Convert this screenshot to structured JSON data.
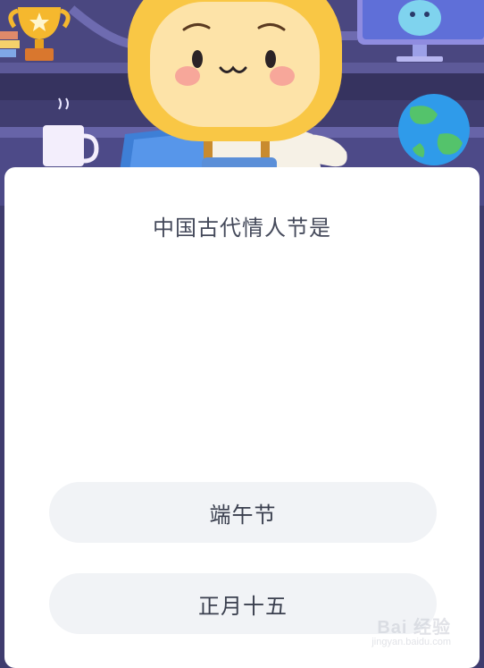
{
  "quiz": {
    "question": "中国古代情人节是",
    "options": [
      {
        "label": "端午节"
      },
      {
        "label": "正月十五"
      }
    ]
  },
  "watermark": {
    "logo": "Bai 经验",
    "url": "jingyan.baidu.com"
  },
  "colors": {
    "banner_bg": "#3f3c6e",
    "card_bg": "#ffffff",
    "option_bg": "#f1f3f6",
    "question_text": "#44495a",
    "character_yellow": "#f9c745"
  },
  "icons": [
    "trophy-icon",
    "mug-icon",
    "globe-icon",
    "monitor-icon",
    "mascot-character"
  ]
}
